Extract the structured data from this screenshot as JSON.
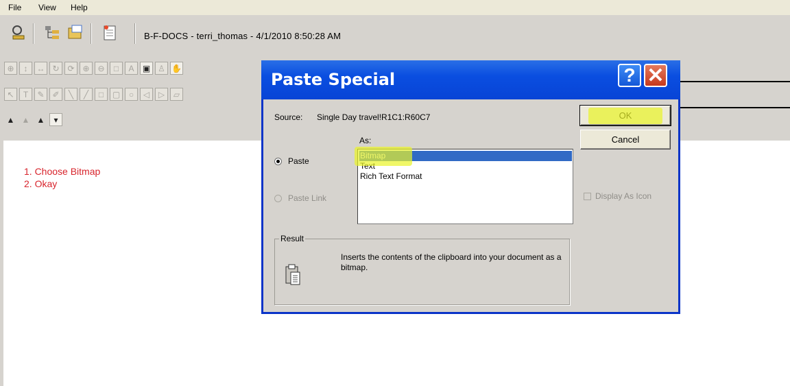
{
  "menu": [
    "File",
    "View",
    "Help"
  ],
  "toolbar": {
    "document_title": "B-F-DOCS - terri_thomas - 4/1/2010 8:50:28 AM"
  },
  "notes": [
    "1.  Choose Bitmap",
    "2.   Okay"
  ],
  "dialog": {
    "title": "Paste Special",
    "help_label": "?",
    "close_label": "✕",
    "source_label": "Source:",
    "source_value": "Single Day travel!R1C1:R60C7",
    "as_label": "As:",
    "paste_option": "Paste",
    "paste_link_option": "Paste Link",
    "formats": [
      "Bitmap",
      "Text",
      "Rich Text Format"
    ],
    "selected_format": "Bitmap",
    "ok_label": "OK",
    "cancel_label": "Cancel",
    "display_as_icon_label": "Display As Icon",
    "result_label": "Result",
    "result_text": "Inserts the contents of the clipboard into your document as a bitmap."
  },
  "colors": {
    "highlight": "#e9f328",
    "selection": "#316ac5",
    "note_text": "#d8242c",
    "titlebar": "#0a4ee0"
  }
}
